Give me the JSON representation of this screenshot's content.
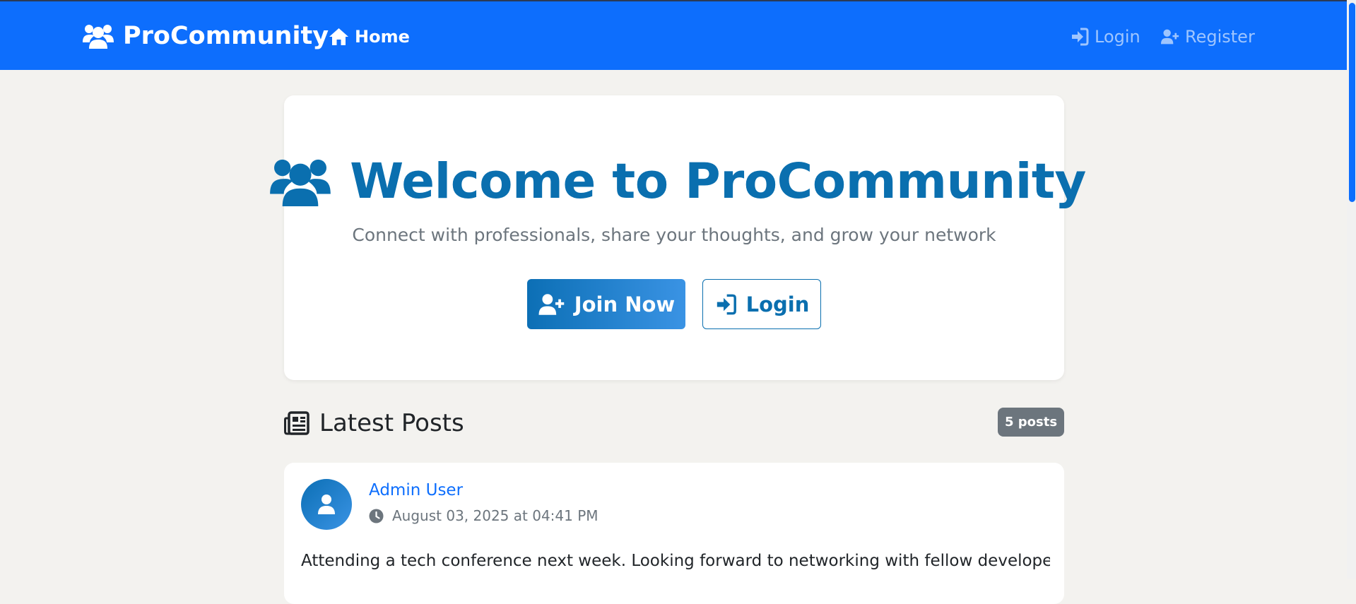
{
  "navbar": {
    "brand": "ProCommunity",
    "brand_icon": "users-icon",
    "home_label": "Home",
    "home_icon": "home-icon",
    "login_label": "Login",
    "login_icon": "sign-in-icon",
    "register_label": "Register",
    "register_icon": "user-plus-icon",
    "color": "#0d6efd"
  },
  "hero": {
    "title": "Welcome to ProCommunity",
    "title_icon": "users-icon",
    "subtitle": "Connect with professionals, share your thoughts, and grow your network",
    "join_label": "Join Now",
    "login_label": "Login",
    "accent_color": "#0a6faf"
  },
  "posts_section": {
    "heading": "Latest Posts",
    "heading_icon": "newspaper-icon",
    "count_badge": "5 posts",
    "posts": [
      {
        "author": "Admin User",
        "timestamp": "August 03, 2025 at 04:41 PM",
        "body": "Attending a tech conference next week. Looking forward to networking with fellow developers and"
      }
    ]
  }
}
